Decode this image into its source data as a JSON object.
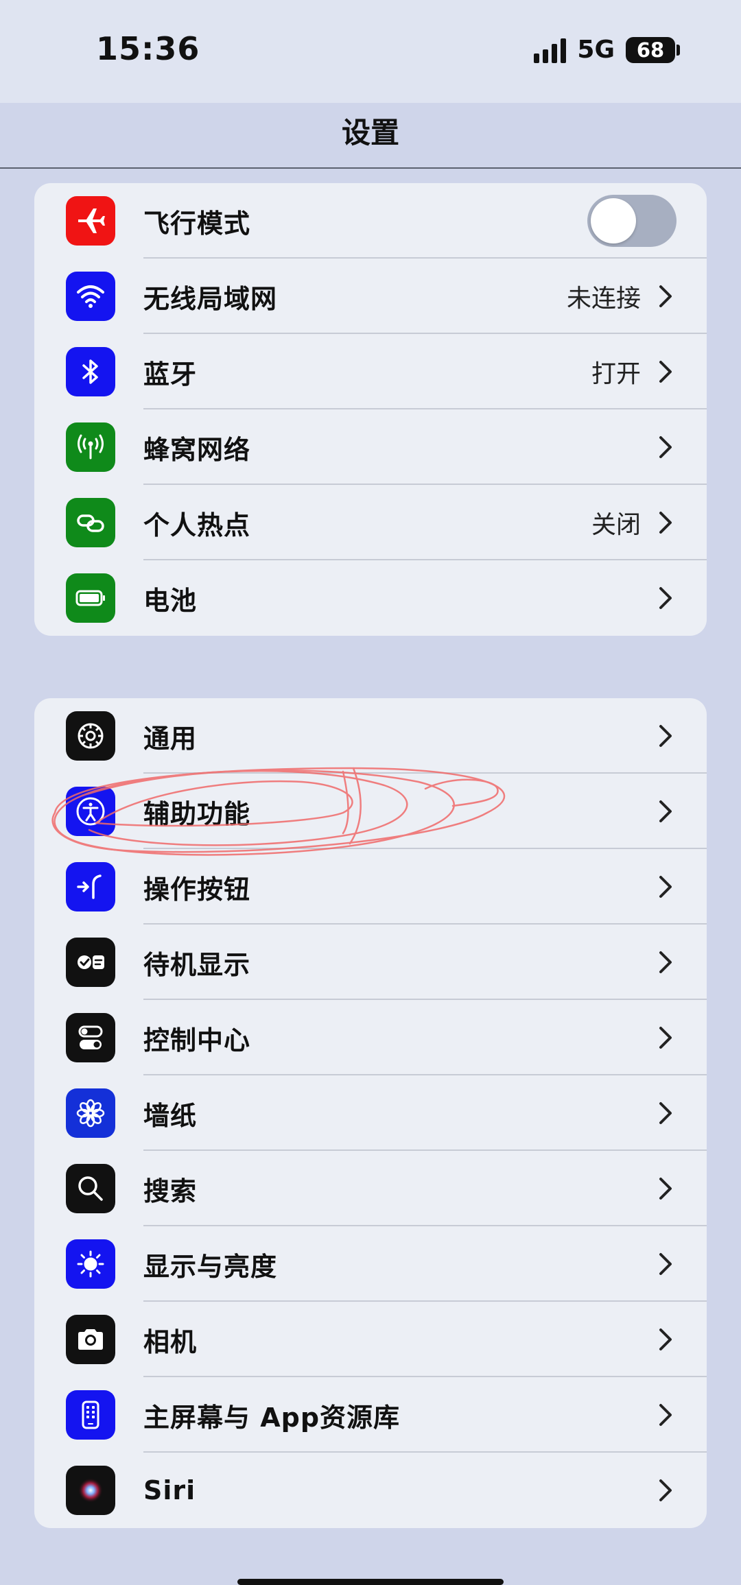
{
  "status_bar": {
    "time": "15:36",
    "network": "5G",
    "battery": "68"
  },
  "nav": {
    "title": "设置"
  },
  "colors": {
    "airplane": "#f01414",
    "blue": "#1414f0",
    "green": "#0f8a1a",
    "black": "#111111",
    "toggle_off": "#a7afc1",
    "annotation_red": "#f06a6a"
  },
  "groups": [
    {
      "items": [
        {
          "label": "飞行模式",
          "icon": "airplane-icon",
          "control": "toggle",
          "toggle_on": false
        },
        {
          "label": "无线局域网",
          "icon": "wifi-icon",
          "value": "未连接"
        },
        {
          "label": "蓝牙",
          "icon": "bluetooth-icon",
          "value": "打开"
        },
        {
          "label": "蜂窝网络",
          "icon": "cellular-icon"
        },
        {
          "label": "个人热点",
          "icon": "hotspot-icon",
          "value": "关闭"
        },
        {
          "label": "电池",
          "icon": "battery-icon"
        }
      ]
    },
    {
      "items": [
        {
          "label": "通用",
          "icon": "gear-icon"
        },
        {
          "label": "辅助功能",
          "icon": "accessibility-icon"
        },
        {
          "label": "操作按钮",
          "icon": "action-button-icon"
        },
        {
          "label": "待机显示",
          "icon": "standby-icon"
        },
        {
          "label": "控制中心",
          "icon": "control-center-icon"
        },
        {
          "label": "墙纸",
          "icon": "wallpaper-icon"
        },
        {
          "label": "搜索",
          "icon": "search-icon"
        },
        {
          "label": "显示与亮度",
          "icon": "brightness-icon"
        },
        {
          "label": "相机",
          "icon": "camera-icon"
        },
        {
          "label": "主屏幕与 App资源库",
          "icon": "home-screen-icon"
        },
        {
          "label": "Siri",
          "icon": "siri-icon"
        }
      ]
    }
  ]
}
